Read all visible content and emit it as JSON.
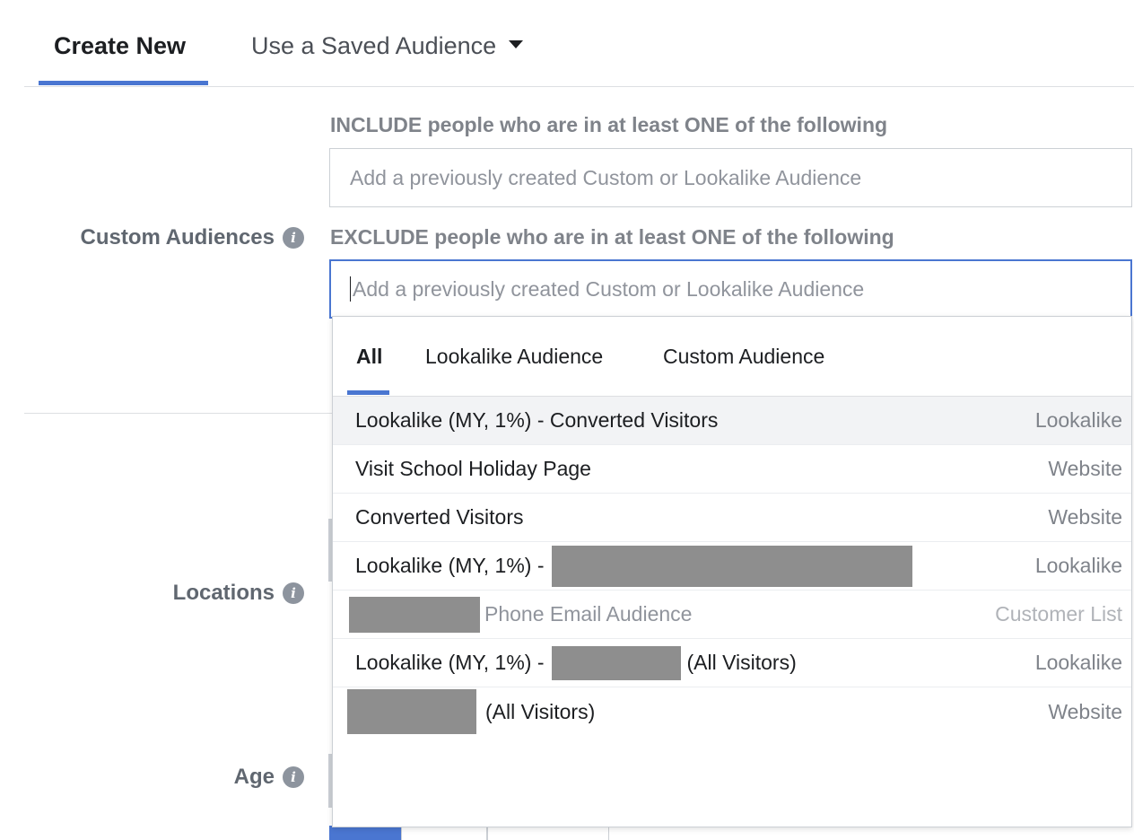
{
  "tabs": {
    "create_new": "Create New",
    "saved_audience": "Use a Saved Audience"
  },
  "custom_audiences": {
    "label": "Custom Audiences",
    "include_text": "INCLUDE people who are in at least ONE of the following",
    "include_placeholder": "Add a previously created Custom or Lookalike Audience",
    "exclude_text": "EXCLUDE people who are in at least ONE of the following",
    "exclude_placeholder": "Add a previously created Custom or Lookalike Audience"
  },
  "dropdown": {
    "tabs": [
      "All",
      "Lookalike Audience",
      "Custom Audience"
    ],
    "items": [
      {
        "name": "Lookalike (MY, 1%) - Converted Visitors",
        "type": "Lookalike"
      },
      {
        "name": "Visit School Holiday Page",
        "type": "Website"
      },
      {
        "name": "Converted Visitors",
        "type": "Website"
      },
      {
        "name_prefix": "Lookalike (MY, 1%) -",
        "type": "Lookalike"
      },
      {
        "name_suffix": "Phone Email Audience",
        "type": "Customer List"
      },
      {
        "name_prefix": "Lookalike (MY, 1%) -",
        "name_suffix": "(All Visitors)",
        "type": "Lookalike"
      },
      {
        "name_suffix": "(All Visitors)",
        "type": "Website"
      }
    ]
  },
  "locations": {
    "label": "Locations"
  },
  "age": {
    "label": "Age"
  },
  "icons": {
    "info": "i",
    "caret": "caret-down-icon"
  },
  "colors": {
    "accent": "#4a76d1",
    "label_gray": "#606770",
    "redaction": "#8e8e8e"
  }
}
